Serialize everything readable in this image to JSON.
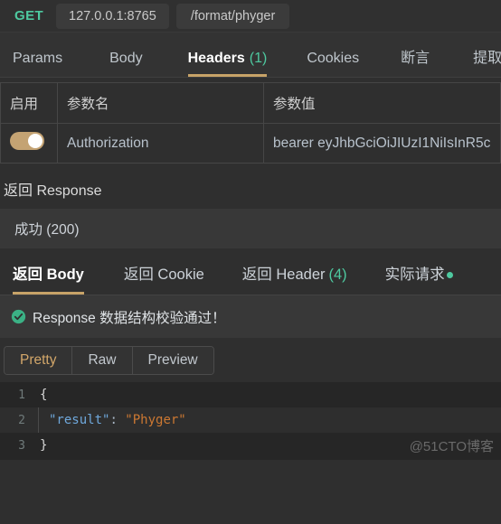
{
  "request": {
    "method": "GET",
    "host": "127.0.0.1:8765",
    "path": "/format/phyger",
    "tabs": [
      {
        "label": "Params",
        "count": "",
        "active": false
      },
      {
        "label": "Body",
        "count": "",
        "active": false
      },
      {
        "label": "Headers",
        "count": "(1)",
        "active": true
      },
      {
        "label": "Cookies",
        "count": "",
        "active": false
      },
      {
        "label": "断言",
        "count": "",
        "active": false
      },
      {
        "label": "提取",
        "count": "",
        "active": false
      }
    ]
  },
  "params_table": {
    "headers": [
      "启用",
      "参数名",
      "参数值"
    ],
    "rows": [
      {
        "enabled": true,
        "name": "Authorization",
        "value": "bearer eyJhbGciOiJIUzI1NiIsInR5c"
      }
    ]
  },
  "response": {
    "title": "返回 Response",
    "status": "成功 (200)",
    "tabs": [
      {
        "label": "返回 Body",
        "count": "",
        "dot": false,
        "active": true
      },
      {
        "label": "返回 Cookie",
        "count": "",
        "dot": false,
        "active": false
      },
      {
        "label": "返回 Header",
        "count": "(4)",
        "dot": false,
        "active": false
      },
      {
        "label": "实际请求",
        "count": "",
        "dot": true,
        "active": false
      }
    ],
    "validation": "Response 数据结构校验通过！",
    "view_modes": [
      {
        "label": "Pretty",
        "active": true
      },
      {
        "label": "Raw",
        "active": false
      },
      {
        "label": "Preview",
        "active": false
      }
    ],
    "body_lines": [
      {
        "num": "1",
        "open": "{",
        "key": "",
        "colon": "",
        "value": ""
      },
      {
        "num": "2",
        "open": "",
        "key": "\"result\"",
        "colon": ": ",
        "value": "\"Phyger\""
      },
      {
        "num": "3",
        "open": "}",
        "key": "",
        "colon": "",
        "value": ""
      }
    ]
  },
  "watermark": "@51CTO博客",
  "colors": {
    "accent_gold": "#c7a368",
    "method_green": "#4ec9a0",
    "toggle_on": "#c4a373",
    "page_bg": "#2f2f2f",
    "code_bg": "#262626"
  }
}
